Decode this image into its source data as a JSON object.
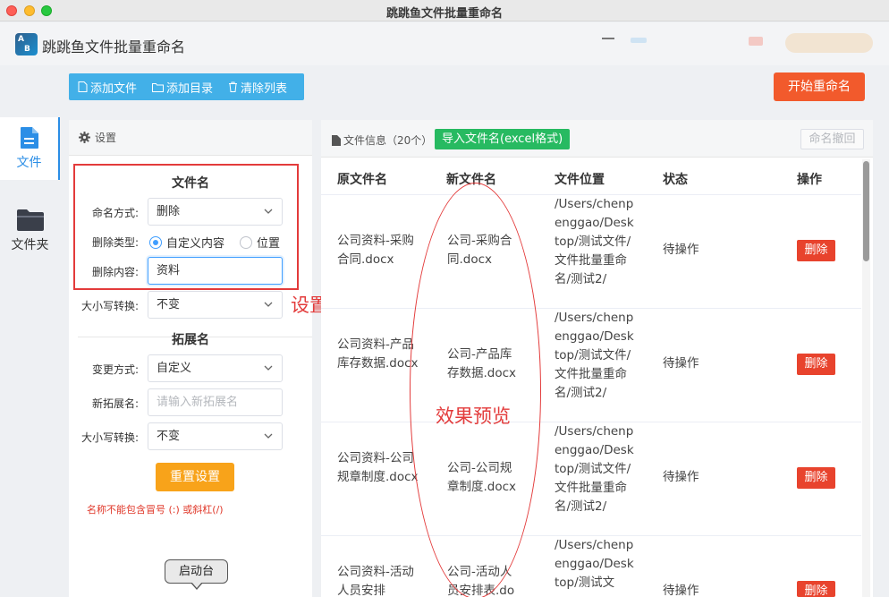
{
  "window": {
    "title": "跳跳鱼文件批量重命名"
  },
  "app": {
    "name": "跳跳鱼文件批量重命名",
    "logo_text_1": "A",
    "logo_text_2": "B"
  },
  "nav": {
    "file_label": "文件",
    "folder_label": "文件夹"
  },
  "toolbar": {
    "add_file": "添加文件",
    "add_dir": "添加目录",
    "clear_list": "清除列表",
    "start": "开始重命名"
  },
  "settings": {
    "header": "设置",
    "filename_section": "文件名",
    "naming_mode_label": "命名方式:",
    "naming_mode_value": "删除",
    "delete_type_label": "删除类型:",
    "delete_type_opt1": "自定义内容",
    "delete_type_opt2": "位置",
    "delete_content_label": "删除内容:",
    "delete_content_value": "资料",
    "case_label": "大小写转换:",
    "case_value": "不变",
    "ext_section": "拓展名",
    "change_mode_label": "变更方式:",
    "change_mode_value": "自定义",
    "new_ext_label": "新拓展名:",
    "new_ext_placeholder": "请输入新拓展名",
    "ext_case_label": "大小写转换:",
    "ext_case_value": "不变",
    "reset": "重置设置",
    "warning": "名称不能包含冒号 (:) 或斜杠(/)"
  },
  "annotations": {
    "settings": "设置",
    "preview": "效果预览"
  },
  "filepanel": {
    "title": "文件信息（20个）",
    "import_btn": "导入文件名(excel格式)",
    "undo_btn": "命名撤回",
    "columns": {
      "orig": "原文件名",
      "new": "新文件名",
      "loc": "文件位置",
      "status": "状态",
      "action": "操作"
    },
    "rows": [
      {
        "orig": "公司资料-采购合同.docx",
        "new": "公司-采购合同.docx",
        "loc": "/Users/chenpenggao/Desktop/测试文件/文件批量重命名/测试2/",
        "status": "待操作",
        "action": "删除"
      },
      {
        "orig": "公司资料-产品库存数据.docx",
        "new": "公司-产品库存数据.docx",
        "loc": "/Users/chenpenggao/Desktop/测试文件/文件批量重命名/测试2/",
        "status": "待操作",
        "action": "删除"
      },
      {
        "orig": "公司资料-公司规章制度.docx",
        "new": "公司-公司规章制度.docx",
        "loc": "/Users/chenpenggao/Desktop/测试文件/文件批量重命名/测试2/",
        "status": "待操作",
        "action": "删除"
      },
      {
        "orig": "公司资料-活动人员安排",
        "new": "公司-活动人员安排表.doc",
        "loc": "/Users/chenpenggao/Desktop/测试文",
        "status": "待操作",
        "action": "删除"
      }
    ]
  },
  "tooltip": {
    "text": "启动台"
  },
  "colors": {
    "accent": "#42b0e8",
    "start": "#f25a2c",
    "delete": "#e8432d",
    "import": "#27ba61",
    "reset": "#f8a31a",
    "annotation": "#e33b3b"
  }
}
